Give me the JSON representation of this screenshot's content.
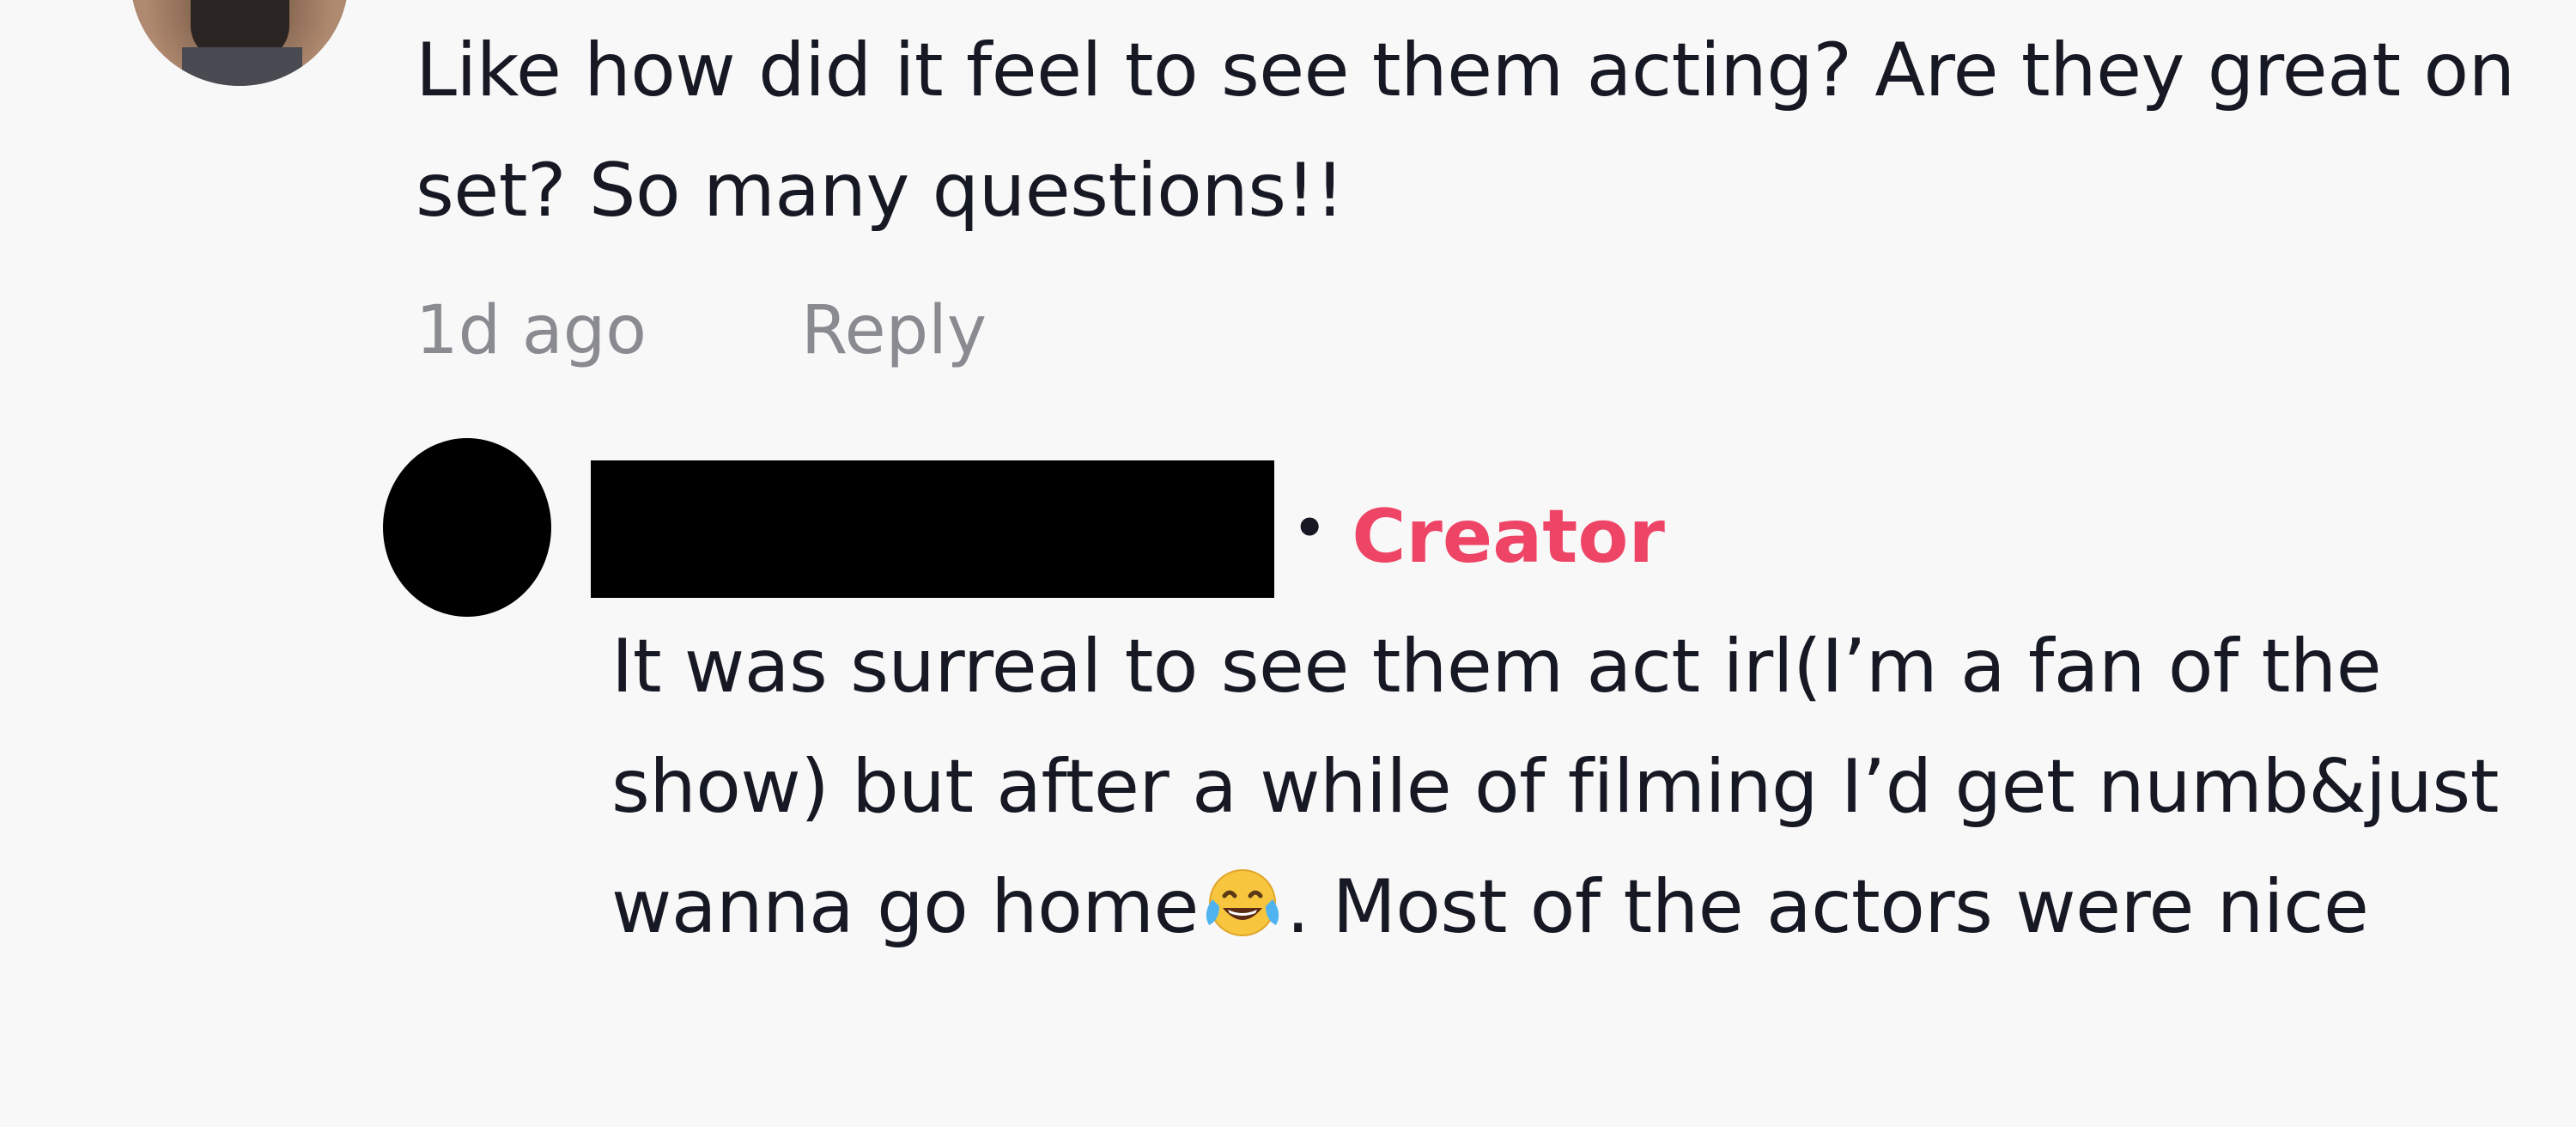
{
  "parent_comment": {
    "text": "Like how did it feel to see them acting? Are they great on set? So many questions!!",
    "timestamp": "1d ago",
    "reply_label": "Reply"
  },
  "reply_comment": {
    "tag": "Creator",
    "text_before_emoji": "It was surreal to see them act irl(I’m a fan of the show) but after a while of filming I’d get numb&just wanna go home",
    "emoji": "face-with-tears-of-joy-icon",
    "text_after_emoji": ". Most of the actors were nice"
  },
  "colors": {
    "background": "#f8f8f9",
    "text": "#161823",
    "meta": "#8a8b91",
    "creator": "#ee4566",
    "redaction": "#000000"
  }
}
